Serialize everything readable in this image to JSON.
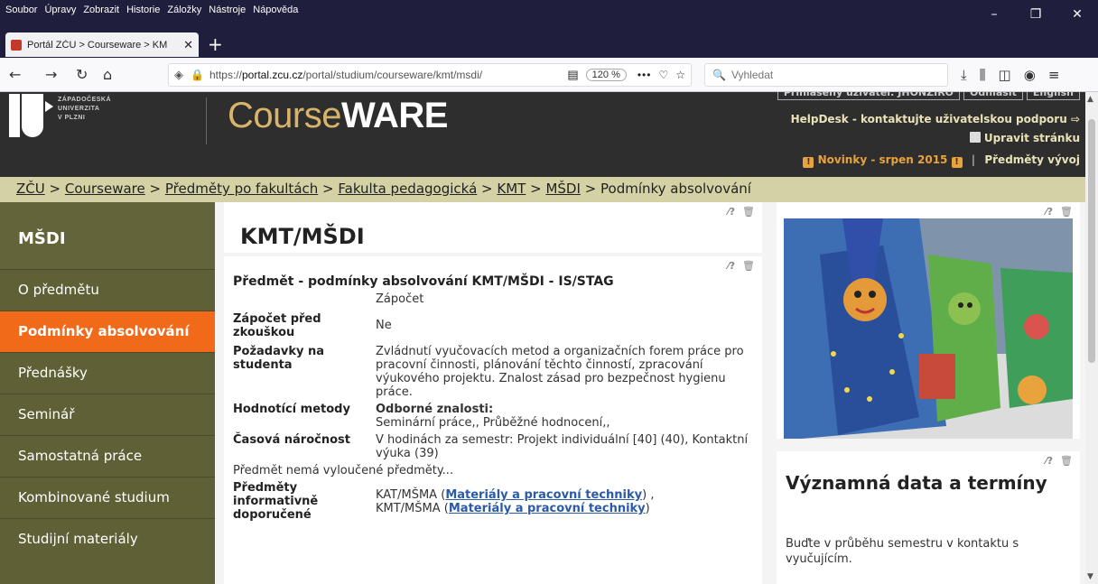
{
  "browser": {
    "menu": [
      "Soubor",
      "Úpravy",
      "Zobrazit",
      "Historie",
      "Záložky",
      "Nástroje",
      "Nápověda"
    ],
    "tab_title": "Portál ZČU > Courseware > KM",
    "url_host": "portal.zcu.cz",
    "url_prefix": "https://",
    "url_rest": "/portal/studium/courseware/kmt/msdi/",
    "zoom": "120 %",
    "search_placeholder": "Vyhledat"
  },
  "header": {
    "uni_line1": "ZÁPADOČESKÁ",
    "uni_line2": "UNIVERZITA",
    "uni_line3": "V PLZNI",
    "site_title_a": "Course",
    "site_title_b": "WARE",
    "login_label": "Přihlášený uživatel: JHONZIRO",
    "logout_label": "Odhlásit",
    "lang_label": "English",
    "helpdesk": "HelpDesk - kontaktujte uživatelskou podporu ⇨",
    "edit_page": "Upravit stránku",
    "news": "Novinky - srpen 2015",
    "subjects": "Předměty vývoj"
  },
  "breadcrumb": {
    "items": [
      "ZČU",
      "Courseware",
      "Předměty po fakultách",
      "Fakulta pedagogická",
      "KMT",
      "MŠDI"
    ],
    "current": "Podmínky absolvování",
    "sep": " > "
  },
  "sidebar": {
    "title": "MŠDI",
    "items": [
      {
        "label": "O předmětu"
      },
      {
        "label": "Podmínky absolvování"
      },
      {
        "label": "Přednášky"
      },
      {
        "label": "Seminář"
      },
      {
        "label": "Samostatná práce"
      },
      {
        "label": "Kombinované studium"
      },
      {
        "label": "Studijní materiály"
      }
    ]
  },
  "main": {
    "heading": "KMT/MŠDI",
    "stag_title": "Předmět - podmínky absolvování KMT/MŠDI - IS/STAG",
    "rows": {
      "credit": "Zápočet",
      "credit_before_label": "Zápočet před zkouškou",
      "credit_before_value": "Ne",
      "requirements_label": "Požadavky na studenta",
      "requirements_value": "Zvládnutí vyučovacích metod a organizačních forem práce pro pracovní činnosti, plánování těchto činností, zpracování výukového projektu. Znalost zásad pro bezpečnost hygienu práce.",
      "evaluation_label": "Hodnotící metody",
      "evaluation_head": "Odborné znalosti:",
      "evaluation_value": "Seminární práce,, Průběžné hodnocení,,",
      "time_label": "Časová náročnost",
      "time_value": "V hodinách za semestr: Projekt individuální [40] (40), Kontaktní výuka (39)",
      "excluded": "Předmět nemá vyloučené předměty...",
      "recommended_label": "Předměty informativně doporučené",
      "rec1_code": "KAT/MŠMA",
      "rec1_link": "Materiály a pracovní techniky",
      "rec1_tail": ") ,",
      "rec2_code": "KMT/MŠMA",
      "rec2_link": "Materiály a pracovní techniky",
      "rec2_tail": ")",
      "paren_open": " ("
    }
  },
  "right": {
    "dates_title": "Významná data a termíny",
    "dates_text": "Buďte v průběhu semestru v kontaktu s vyučujícím."
  }
}
